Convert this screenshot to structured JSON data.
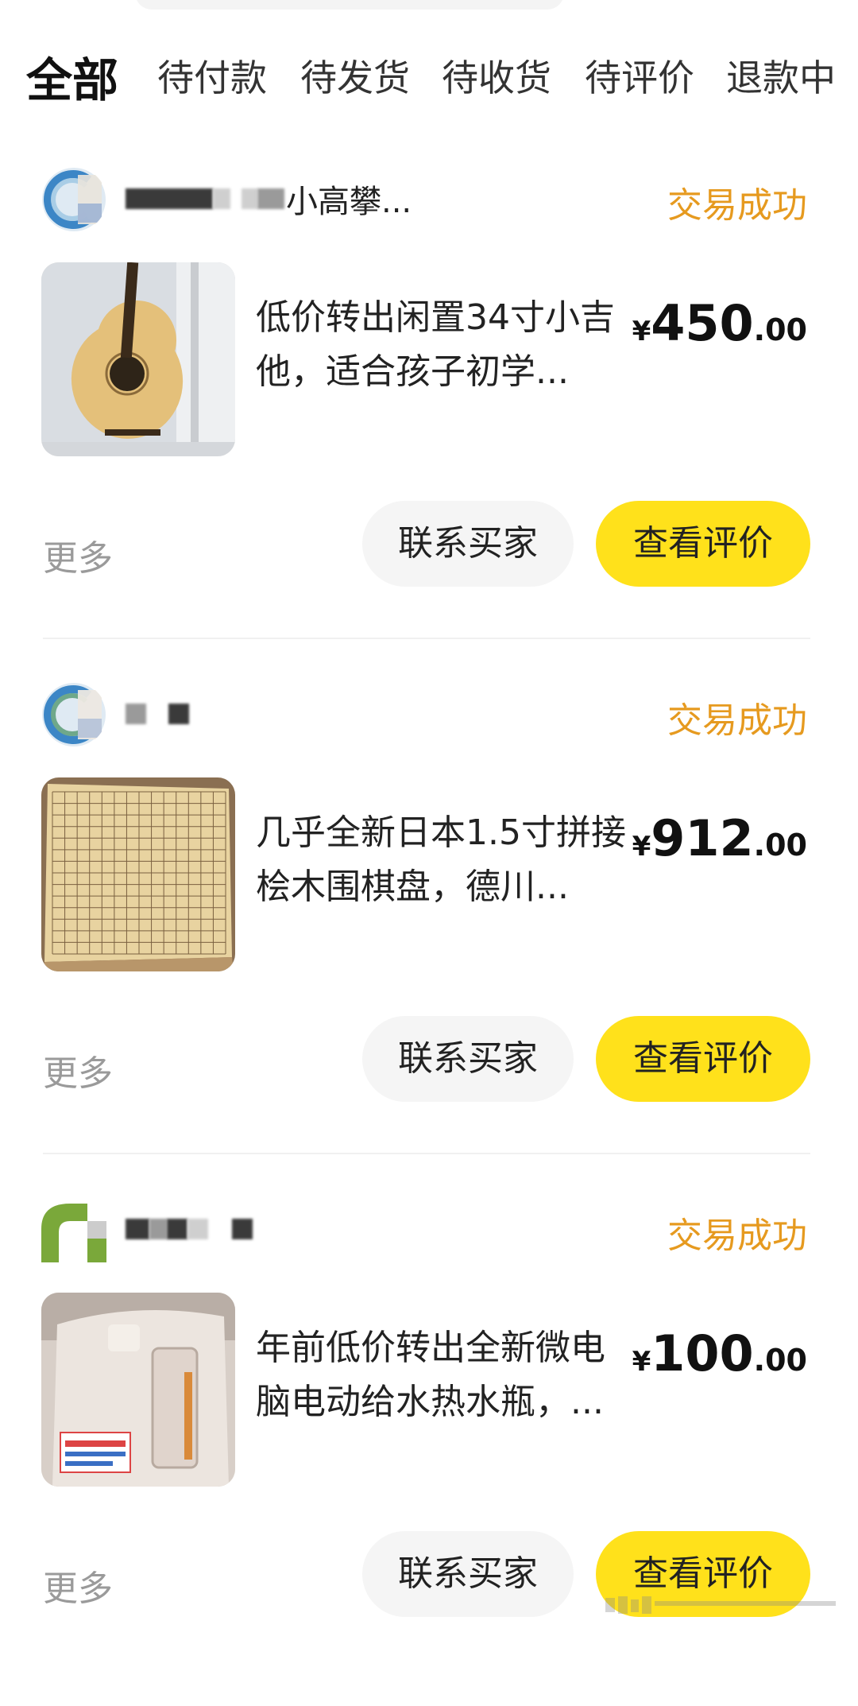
{
  "tabs": [
    {
      "label": "全部",
      "active": true
    },
    {
      "label": "待付款",
      "active": false
    },
    {
      "label": "待发货",
      "active": false
    },
    {
      "label": "待收货",
      "active": false
    },
    {
      "label": "待评价",
      "active": false
    },
    {
      "label": "退款中",
      "active": false
    }
  ],
  "colors": {
    "accent_yellow": "#FFE11B",
    "status_orange": "#E69A1F",
    "muted_text": "#9a9a9a"
  },
  "orders": [
    {
      "seller_name_visible": "小高攀...",
      "status": "交易成功",
      "title": "低价转出闲置34寸小吉他，适合孩子初学...",
      "price_int": "450",
      "price_dec": ".00",
      "currency": "¥",
      "thumbnail_icon": "guitar-image",
      "more_label": "更多",
      "contact_label": "联系买家",
      "review_label": "查看评价"
    },
    {
      "seller_name_visible": "",
      "status": "交易成功",
      "title": "几乎全新日本1.5寸拼接桧木围棋盘，德川...",
      "price_int": "912",
      "price_dec": ".00",
      "currency": "¥",
      "thumbnail_icon": "go-board-image",
      "more_label": "更多",
      "contact_label": "联系买家",
      "review_label": "查看评价"
    },
    {
      "seller_name_visible": "",
      "status": "交易成功",
      "title": "年前低价转出全新微电脑电动给水热水瓶，...",
      "price_int": "100",
      "price_dec": ".00",
      "currency": "¥",
      "thumbnail_icon": "water-dispenser-image",
      "more_label": "更多",
      "contact_label": "联系买家",
      "review_label": "查看评价"
    }
  ]
}
